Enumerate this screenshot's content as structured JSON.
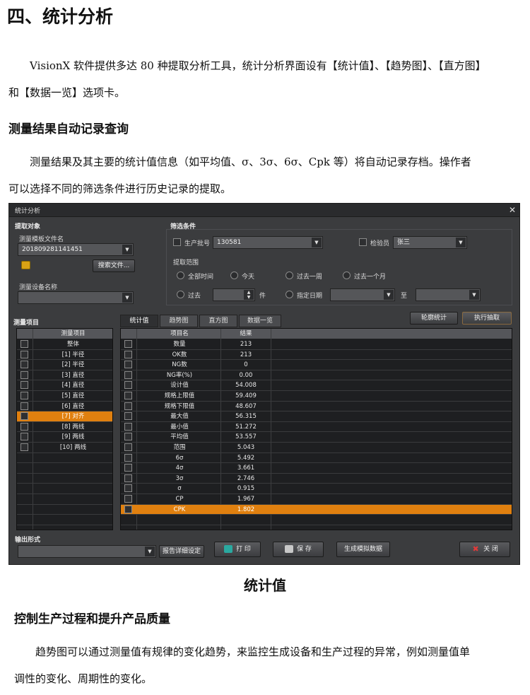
{
  "doc": {
    "heading": "四、统计分析",
    "intro_line1": "VisionX 软件提供多达 80 种提取分析工具，统计分析界面设有【统计值】、【趋势图】、【直方图】",
    "intro_line2": "和【数据一览】选项卡。",
    "section1_title": "测量结果自动记录查询",
    "section1_line1": "测量结果及其主要的统计值信息（如平均值、σ、3σ、6σ、Cpk 等）将自动记录存档。操作者",
    "section1_line2": "可以选择不同的筛选条件进行历史记录的提取。",
    "caption": "统计值",
    "section2_title": "控制生产过程和提升产品质量",
    "section2_line1": "趋势图可以通过测量值有规律的变化趋势，来监控生成设备和生产过程的异常，例如测量值单",
    "section2_line2": "调性的变化、周期性的变化。"
  },
  "window": {
    "title": "统计分析",
    "close_glyph": "✕",
    "extract_group": {
      "title": "提取对象",
      "template_label": "测量模板文件名",
      "template_value": "201809281141451",
      "browse_button": "搜索文件...",
      "device_label": "测量设备名称",
      "device_value": ""
    },
    "filter_group": {
      "title": "筛选条件",
      "batch_label": "生产批号",
      "batch_value": "130581",
      "inspector_label": "检验员",
      "inspector_value": "张三",
      "range_label": "提取范围",
      "radio_all": "全部时间",
      "radio_today": "今天",
      "radio_week": "过去一周",
      "radio_month": "过去一个月",
      "radio_past": "过去",
      "past_unit": "件",
      "past_value": "",
      "radio_date": "指定日期",
      "date_to": "至"
    },
    "items_group": {
      "title": "测量项目",
      "header": "测量项目",
      "items": [
        "整体",
        "[1] 半径",
        "[2] 半径",
        "[3] 直径",
        "[4] 直径",
        "[5] 直径",
        "[6] 直径",
        "[7] 对齐",
        "[8] 两线",
        "[9] 两线",
        "[10] 两线"
      ],
      "selected_index": 7
    },
    "tabs": [
      "统计值",
      "趋势图",
      "直方图",
      "数据一览"
    ],
    "active_tab": 0,
    "contour_button": "轮廓统计",
    "execute_button": "执行抽取",
    "stats": {
      "col_name": "项目名",
      "col_result": "结果",
      "rows": [
        {
          "name": "数量",
          "value": "213"
        },
        {
          "name": "OK数",
          "value": "213"
        },
        {
          "name": "NG数",
          "value": "0"
        },
        {
          "name": "NG率(%)",
          "value": "0.00"
        },
        {
          "name": "设计值",
          "value": "54.008"
        },
        {
          "name": "规格上限值",
          "value": "59.409"
        },
        {
          "name": "规格下限值",
          "value": "48.607"
        },
        {
          "name": "最大值",
          "value": "56.315"
        },
        {
          "name": "最小值",
          "value": "51.272"
        },
        {
          "name": "平均值",
          "value": "53.557"
        },
        {
          "name": "范围",
          "value": "5.043"
        },
        {
          "name": "6σ",
          "value": "5.492"
        },
        {
          "name": "4σ",
          "value": "3.661"
        },
        {
          "name": "3σ",
          "value": "2.746"
        },
        {
          "name": "σ",
          "value": "0.915"
        },
        {
          "name": "CP",
          "value": "1.967"
        },
        {
          "name": "CPK",
          "value": "1.802"
        }
      ],
      "selected_index": 16
    },
    "output": {
      "title": "输出形式",
      "format_value": "",
      "report_button": "报告详细设定",
      "print_button": "打 印",
      "save_button": "保 存",
      "simulate_button": "生成模拟数据",
      "close_button": "关 闭"
    },
    "colors": {
      "selection": "#e0800f",
      "panel": "#3b3c3e",
      "titlebar": "#2a2b2d"
    }
  }
}
